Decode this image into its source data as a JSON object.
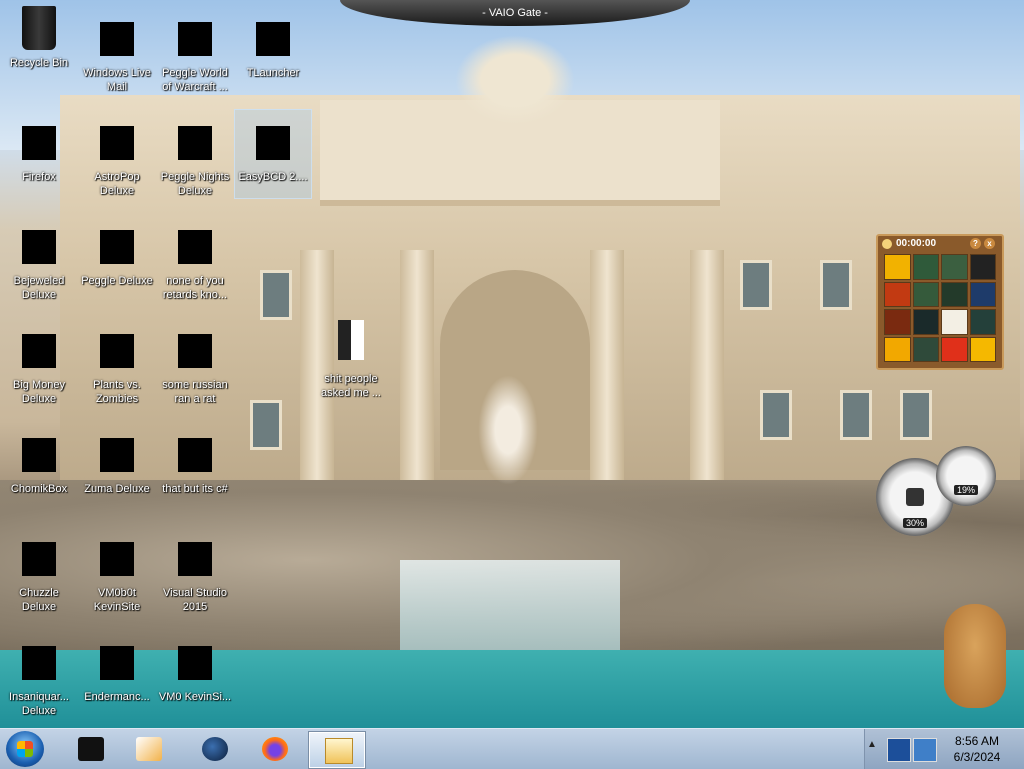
{
  "window_title": "- VAIO Gate -",
  "desktop_icons": [
    {
      "label": "Recycle Bin",
      "icon": "recycle-bin-icon"
    },
    {
      "label": "Windows Live Mail",
      "icon": "mail-icon"
    },
    {
      "label": "Peggle World of Warcraft ...",
      "icon": "game-icon"
    },
    {
      "label": "TLauncher",
      "icon": "minecraft-icon"
    },
    {
      "label": "Firefox",
      "icon": "firefox-icon"
    },
    {
      "label": "AstroPop Deluxe",
      "icon": "game-icon"
    },
    {
      "label": "Peggle Nights Deluxe",
      "icon": "game-icon"
    },
    {
      "label": "EasyBCD 2....",
      "icon": "easybcd-icon"
    },
    {
      "label": "Bejeweled Deluxe",
      "icon": "gem-icon"
    },
    {
      "label": "Peggle Deluxe",
      "icon": "game-icon"
    },
    {
      "label": "none of you retards kno...",
      "icon": "file-icon"
    },
    {
      "label": "shit people asked me ...",
      "icon": "document-icon"
    },
    {
      "label": "Big Money Deluxe",
      "icon": "game-icon"
    },
    {
      "label": "Plants vs. Zombies",
      "icon": "plant-icon"
    },
    {
      "label": "some russian ran a rat",
      "icon": "file-icon"
    },
    {
      "label": "ChomikBox",
      "icon": "chomikbox-icon"
    },
    {
      "label": "Zuma Deluxe",
      "icon": "zuma-icon"
    },
    {
      "label": "that but its c#",
      "icon": "file-icon"
    },
    {
      "label": "Chuzzle Deluxe",
      "icon": "game-icon"
    },
    {
      "label": "VM0b0t KevinSite",
      "icon": "file-icon"
    },
    {
      "label": "Visual Studio 2015",
      "icon": "visual-studio-icon"
    },
    {
      "label": "Insaniquar... Deluxe",
      "icon": "game-icon"
    },
    {
      "label": "Endermanc...",
      "icon": "file-icon"
    },
    {
      "label": "VM0 KevinSi...",
      "icon": "file-icon"
    }
  ],
  "puzzle_gadget": {
    "timer": "00:00:00",
    "help": "?",
    "close": "x"
  },
  "cpu_meter": {
    "cpu": "30%",
    "memory": "19%"
  },
  "taskbar": {
    "items": [
      "start-button",
      "black-box-app",
      "media-player",
      "globe-app",
      "firefox",
      "explorer"
    ],
    "clock_time": "8:56 AM",
    "clock_date": "6/3/2024"
  }
}
